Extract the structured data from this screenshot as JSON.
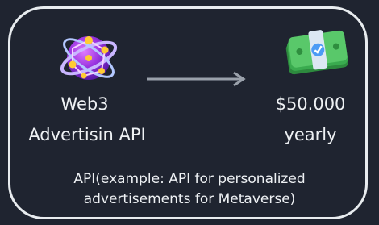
{
  "product": {
    "name_line1": "Web3",
    "name_line2": "Advertisin API",
    "icon": "web3-sphere-icon"
  },
  "price": {
    "amount": "$50.000",
    "period": "yearly",
    "icon": "money-icon"
  },
  "description": {
    "line1": "API(example: API for personalized",
    "line2": "advertisements for Metaverse)"
  },
  "colors": {
    "background": "#1f2430",
    "text": "#eef1f4",
    "border": "#e8ecef",
    "arrow": "#9aa1ab"
  }
}
